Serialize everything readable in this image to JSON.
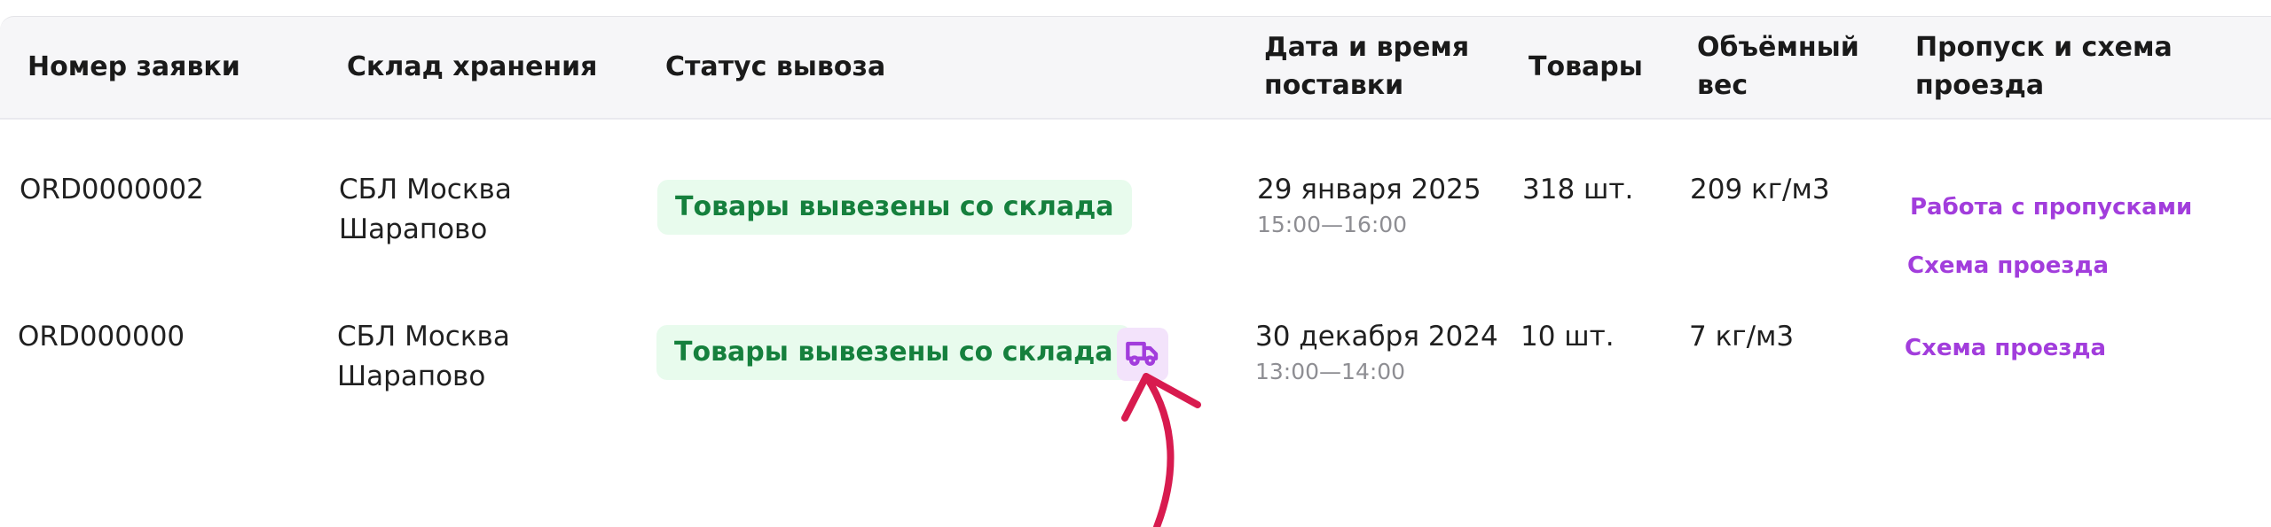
{
  "colors": {
    "header_bg": "#f6f6f8",
    "badge_bg": "#e8fbed",
    "badge_text": "#15803d",
    "link": "#a23ddc",
    "truck_bg": "#f3e3fb",
    "annotation_arrow": "#d81b4f"
  },
  "table": {
    "headers": {
      "order_number": "Номер заявки",
      "warehouse": "Склад хранения",
      "status": "Статус вывоза",
      "datetime_line1": "Дата и время",
      "datetime_line2": "поставки",
      "goods": "Товары",
      "weight_line1": "Объёмный",
      "weight_line2": "вес",
      "pass_line1": "Пропуск и схема",
      "pass_line2": "проезда"
    },
    "rows": [
      {
        "order": "ORD0000002",
        "warehouse_line1": "СБЛ Москва",
        "warehouse_line2": "Шарапово",
        "status": "Товары вывезены со склада",
        "date": "29 января 2025",
        "time": "15:00—16:00",
        "goods": "318 шт.",
        "weight": "209 кг/м3",
        "link_pass": "Работа с пропусками",
        "link_scheme": "Схема проезда"
      },
      {
        "order": "ORD000000",
        "warehouse_line1": "СБЛ Москва",
        "warehouse_line2": "Шарапово",
        "status": "Товары вывезены со склада",
        "date": "30 декабря 2024",
        "time": "13:00—14:00",
        "goods": "10 шт.",
        "weight": "7 кг/м3",
        "link_scheme": "Схема проезда",
        "status_icon": "truck-icon"
      }
    ]
  },
  "annotation": {
    "icon": "curved-arrow-icon"
  }
}
